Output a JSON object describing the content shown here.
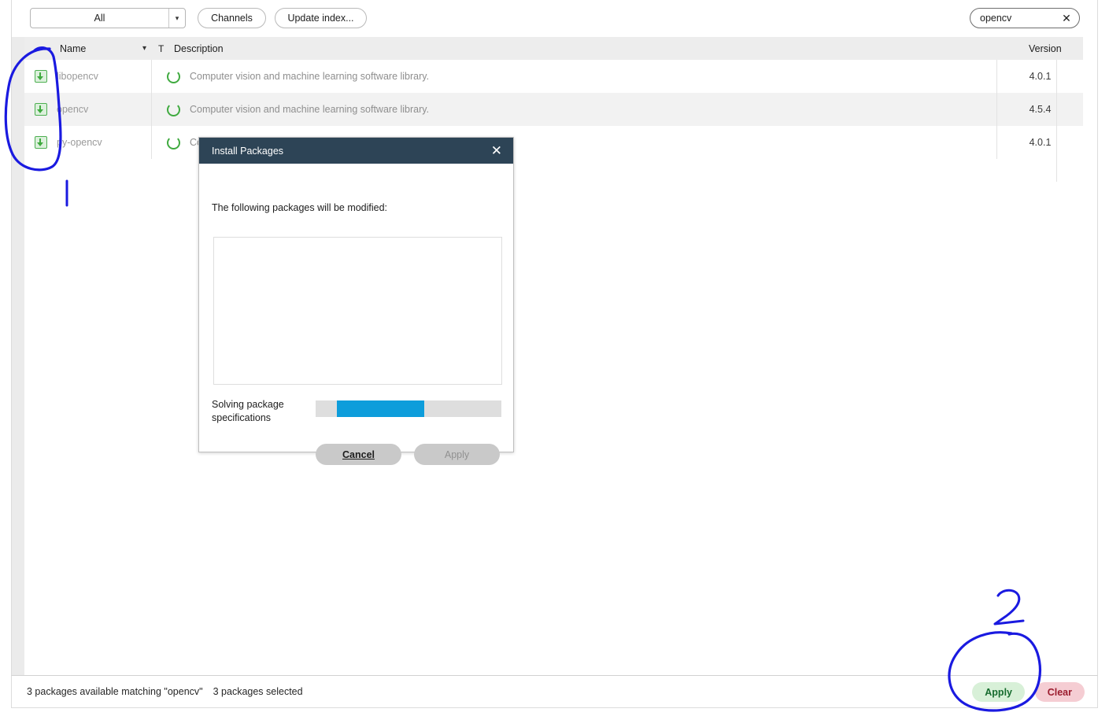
{
  "toolbar": {
    "filter_select": {
      "value": "All",
      "chevron_icon": "chevron-down-icon"
    },
    "channels_label": "Channels",
    "update_index_label": "Update index...",
    "search": {
      "value": "opencv",
      "clear_icon": "close-icon"
    }
  },
  "table": {
    "headers": {
      "name": "Name",
      "sort_icon": "chevron-down-icon",
      "type": "T",
      "description": "Description",
      "version": "Version"
    },
    "rows": [
      {
        "mark_icon": "install-arrow-icon",
        "name": "libopencv",
        "status_icon": "loading-spinner-icon",
        "description": "Computer vision and machine learning software library.",
        "version": "4.0.1"
      },
      {
        "mark_icon": "install-arrow-icon",
        "name": "opencv",
        "status_icon": "loading-spinner-icon",
        "description": "Computer vision and machine learning software library.",
        "version": "4.5.4"
      },
      {
        "mark_icon": "install-arrow-icon",
        "name": "py-opencv",
        "status_icon": "loading-spinner-icon",
        "description": "Computer vision and machine learning software library.",
        "version": "4.0.1"
      }
    ]
  },
  "status_bar": {
    "available_text": "3 packages available matching \"opencv\"",
    "selected_text": "3 packages selected",
    "apply_label": "Apply",
    "clear_label": "Clear"
  },
  "dialog": {
    "title": "Install Packages",
    "close_icon": "close-icon",
    "prompt": "The following packages will be modified:",
    "package_list": [],
    "progress_label": "Solving package specifications",
    "progress_percent": 47,
    "cancel_label": "Cancel",
    "apply_label": "Apply"
  },
  "annotations": {
    "ink_color": "#1a1ae0",
    "marks": [
      {
        "name": "circle-around-checkbox-column",
        "label": ""
      },
      {
        "name": "step-number-1",
        "label": "1"
      },
      {
        "name": "circle-around-apply-button",
        "label": ""
      },
      {
        "name": "step-number-2",
        "label": "2"
      }
    ]
  }
}
